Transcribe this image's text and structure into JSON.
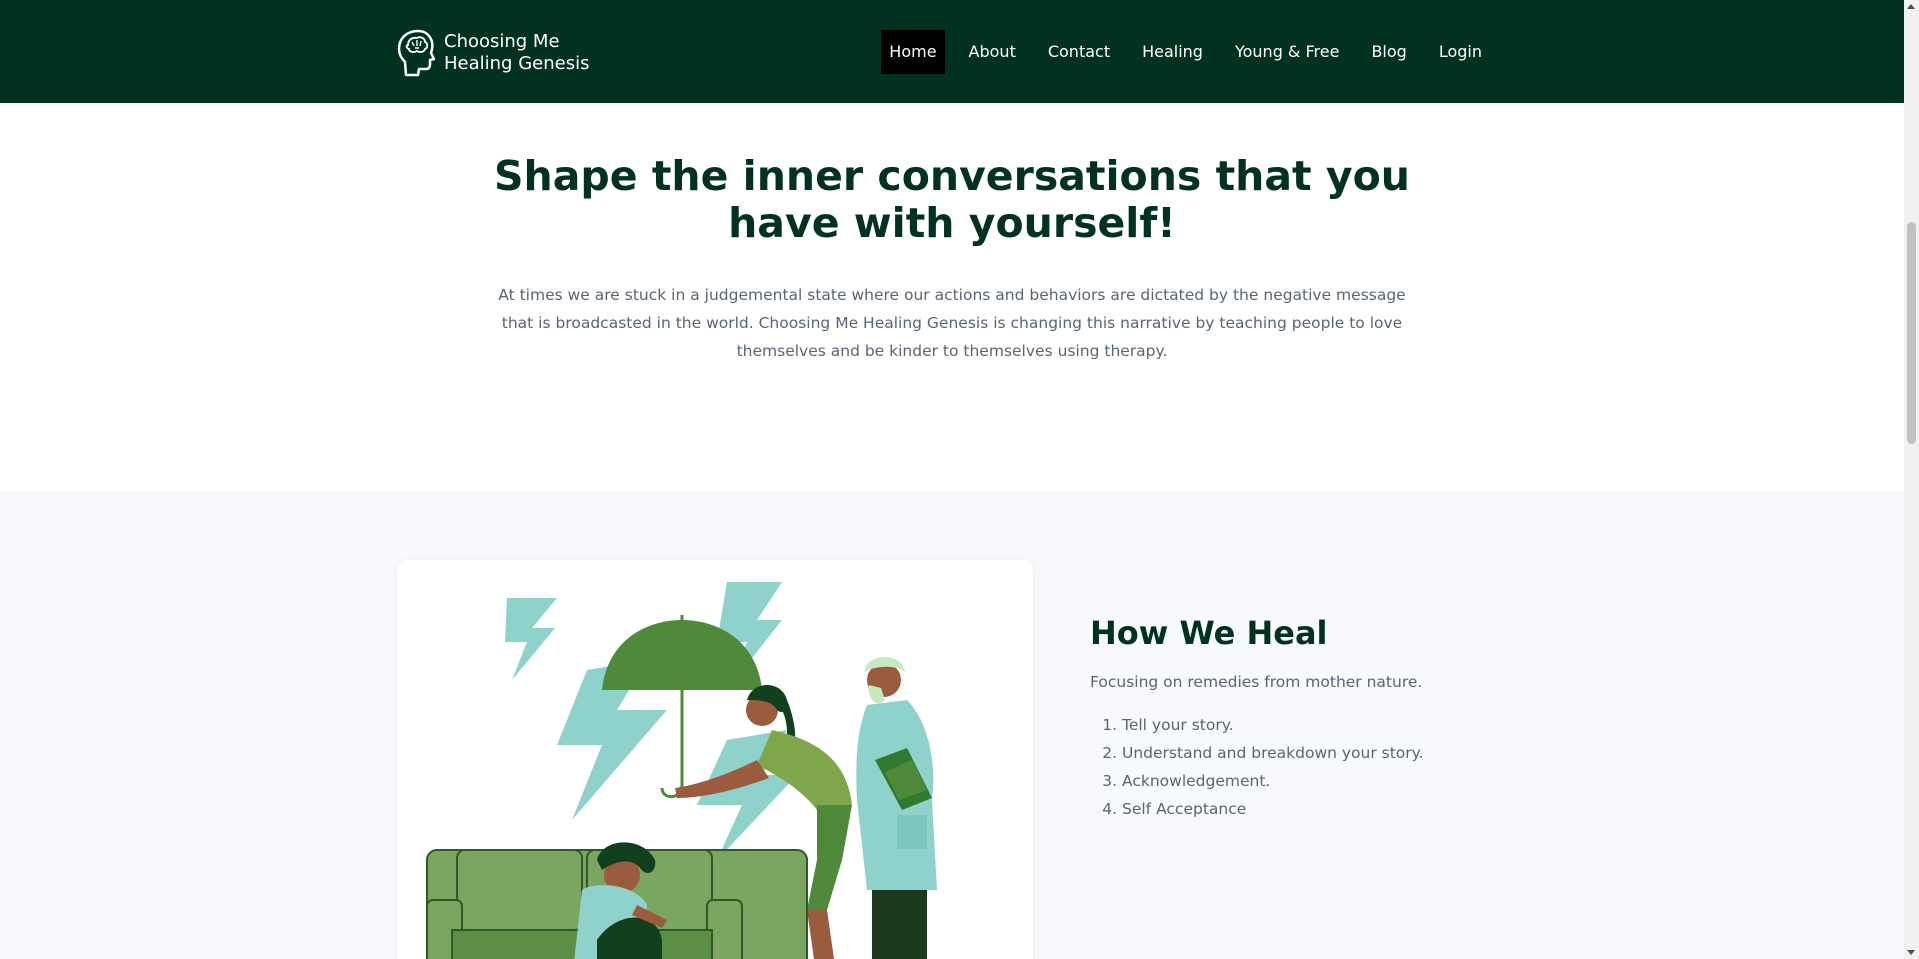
{
  "brand": {
    "name_line1": "Choosing Me",
    "name_line2": "Healing Genesis"
  },
  "nav": {
    "items": [
      {
        "label": "Home",
        "active": true
      },
      {
        "label": "About",
        "active": false
      },
      {
        "label": "Contact",
        "active": false
      },
      {
        "label": "Healing",
        "active": false
      },
      {
        "label": "Young & Free",
        "active": false
      },
      {
        "label": "Blog",
        "active": false
      },
      {
        "label": "Login",
        "active": false
      }
    ]
  },
  "hero": {
    "title": "Shape the inner conversations that you have with yourself!",
    "text": "At times we are stuck in a judgemental state where our actions and behaviors are dictated by the negative message that is broadcasted in the world. Choosing Me Healing Genesis is changing this narrative by teaching people to love themselves and be kinder to themselves using therapy."
  },
  "heal": {
    "title": "How We Heal",
    "subtitle": "Focusing on remedies from mother nature.",
    "steps": [
      "Tell your story.",
      "Understand and breakdown your story.",
      "Acknowledgement.",
      "Self Acceptance"
    ],
    "illustration_icon": "therapy-umbrella-illustration"
  },
  "colors": {
    "brand_dark_green": "#013220",
    "active_nav_bg": "#000000",
    "body_text": "#5a6572",
    "section_bg": "#f7f9fc",
    "illustration_green": "#4f8a3a",
    "lightning_teal": "#8fd1cb"
  }
}
